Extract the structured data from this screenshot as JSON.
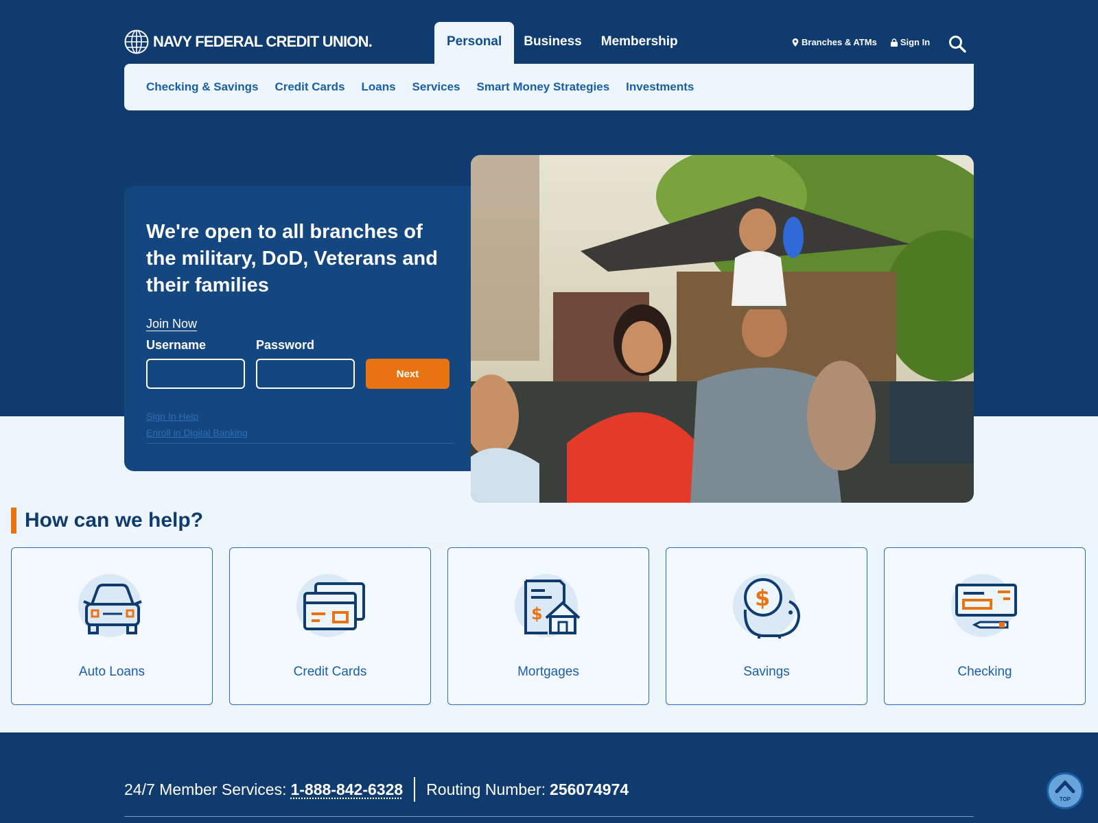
{
  "header": {
    "logo_text": "NAVY FEDERAL CREDIT UNION.",
    "tabs": [
      "Personal",
      "Business",
      "Membership"
    ],
    "utility": {
      "branches": "Branches & ATMs",
      "sign_in": "Sign In"
    }
  },
  "subnav": [
    "Checking & Savings",
    "Credit Cards",
    "Loans",
    "Services",
    "Smart Money Strategies",
    "Investments"
  ],
  "login": {
    "title": "We're open to all branches of the military, DoD, Veterans and their families",
    "join": "Join Now",
    "username_label": "Username",
    "password_label": "Password",
    "next": "Next",
    "sign_in_help": "Sign In Help",
    "enroll": "Enroll in Digital Banking"
  },
  "help": {
    "title": "How can we help?",
    "tiles": [
      {
        "label": "Auto Loans",
        "icon": "car-icon"
      },
      {
        "label": "Credit Cards",
        "icon": "credit-cards-icon"
      },
      {
        "label": "Mortgages",
        "icon": "house-document-icon"
      },
      {
        "label": "Savings",
        "icon": "piggy-bank-icon"
      },
      {
        "label": "Checking",
        "icon": "check-icon"
      }
    ]
  },
  "footer": {
    "member_services_label": "24/7 Member Services:",
    "phone": "1-888-842-6328",
    "routing_label": "Routing Number:",
    "routing_number": "256074974"
  },
  "back_to_top": "TOP",
  "colors": {
    "navy": "#0f3b6e",
    "accent": "#e87411",
    "link": "#1a5ea6",
    "light_bg": "#eef6fd"
  }
}
